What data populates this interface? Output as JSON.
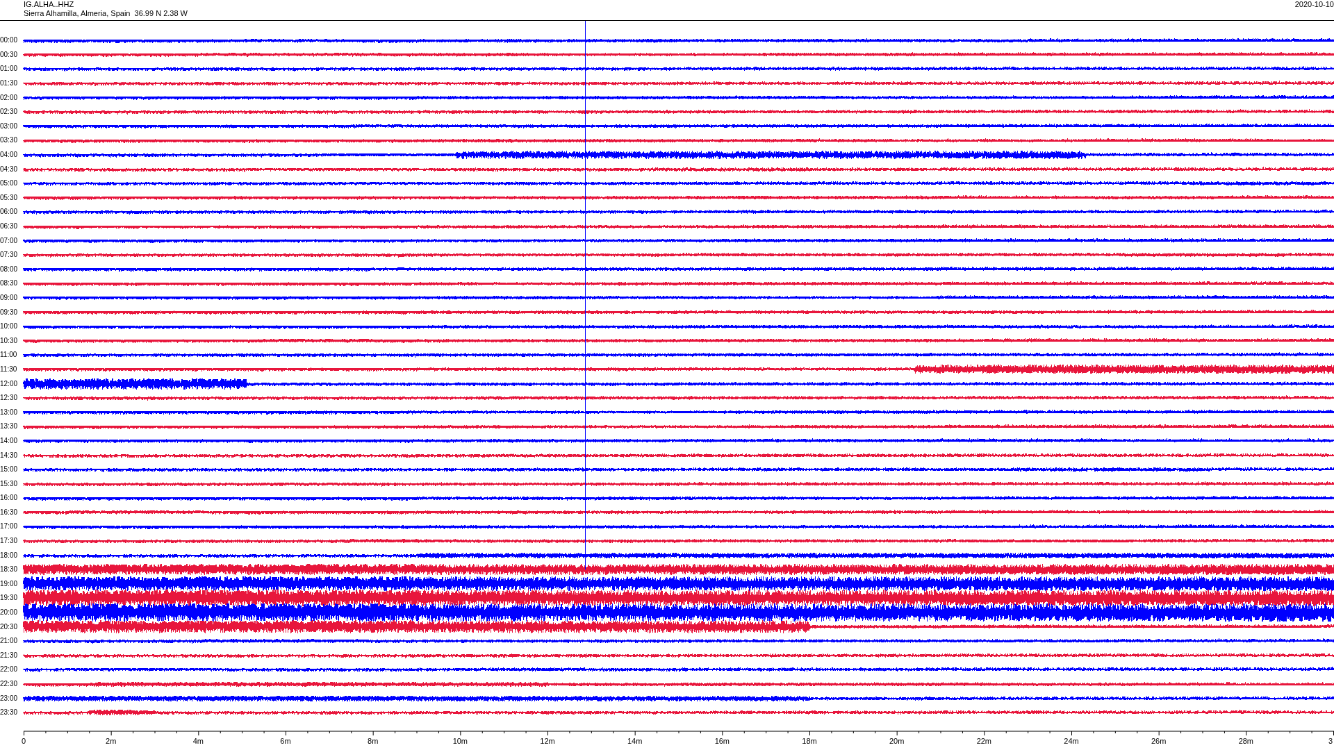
{
  "header": {
    "station": "IG.ALHA..HHZ",
    "location": "Sierra Alhamilla, Almeria, Spain  36.99 N 2.38 W",
    "date": "2020-10-10"
  },
  "rows": [
    {
      "time": "00:00",
      "color": "#0000ff"
    },
    {
      "time": "00:30",
      "color": "#e8163c"
    },
    {
      "time": "01:00",
      "color": "#0000ff"
    },
    {
      "time": "01:30",
      "color": "#e8163c"
    },
    {
      "time": "02:00",
      "color": "#0000ff"
    },
    {
      "time": "02:30",
      "color": "#e8163c"
    },
    {
      "time": "03:00",
      "color": "#0000ff"
    },
    {
      "time": "03:30",
      "color": "#e8163c"
    },
    {
      "time": "04:00",
      "color": "#0000ff"
    },
    {
      "time": "04:30",
      "color": "#e8163c"
    },
    {
      "time": "05:00",
      "color": "#0000ff"
    },
    {
      "time": "05:30",
      "color": "#e8163c"
    },
    {
      "time": "06:00",
      "color": "#0000ff"
    },
    {
      "time": "06:30",
      "color": "#e8163c"
    },
    {
      "time": "07:00",
      "color": "#0000ff"
    },
    {
      "time": "07:30",
      "color": "#e8163c"
    },
    {
      "time": "08:00",
      "color": "#0000ff"
    },
    {
      "time": "08:30",
      "color": "#e8163c"
    },
    {
      "time": "09:00",
      "color": "#0000ff"
    },
    {
      "time": "09:30",
      "color": "#e8163c"
    },
    {
      "time": "10:00",
      "color": "#0000ff"
    },
    {
      "time": "10:30",
      "color": "#e8163c"
    },
    {
      "time": "11:00",
      "color": "#0000ff"
    },
    {
      "time": "11:30",
      "color": "#e8163c"
    },
    {
      "time": "12:00",
      "color": "#0000ff"
    },
    {
      "time": "12:30",
      "color": "#e8163c"
    },
    {
      "time": "13:00",
      "color": "#0000ff"
    },
    {
      "time": "13:30",
      "color": "#e8163c"
    },
    {
      "time": "14:00",
      "color": "#0000ff"
    },
    {
      "time": "14:30",
      "color": "#e8163c"
    },
    {
      "time": "15:00",
      "color": "#0000ff"
    },
    {
      "time": "15:30",
      "color": "#e8163c"
    },
    {
      "time": "16:00",
      "color": "#0000ff"
    },
    {
      "time": "16:30",
      "color": "#e8163c"
    },
    {
      "time": "17:00",
      "color": "#0000ff"
    },
    {
      "time": "17:30",
      "color": "#e8163c"
    },
    {
      "time": "18:00",
      "color": "#0000ff"
    },
    {
      "time": "18:30",
      "color": "#e8163c"
    },
    {
      "time": "19:00",
      "color": "#0000ff"
    },
    {
      "time": "19:30",
      "color": "#e8163c"
    },
    {
      "time": "20:00",
      "color": "#0000ff"
    },
    {
      "time": "20:30",
      "color": "#e8163c"
    },
    {
      "time": "21:00",
      "color": "#0000ff"
    },
    {
      "time": "21:30",
      "color": "#e8163c"
    },
    {
      "time": "22:00",
      "color": "#0000ff"
    },
    {
      "time": "22:30",
      "color": "#e8163c"
    },
    {
      "time": "23:00",
      "color": "#0000ff"
    },
    {
      "time": "23:30",
      "color": "#e8163c"
    }
  ],
  "x_axis": {
    "ticks": [
      "0",
      "2m",
      "4m",
      "6m",
      "8m",
      "10m",
      "12m",
      "14m",
      "16m",
      "18m",
      "20m",
      "22m",
      "24m",
      "26m",
      "28m",
      "3"
    ]
  }
}
